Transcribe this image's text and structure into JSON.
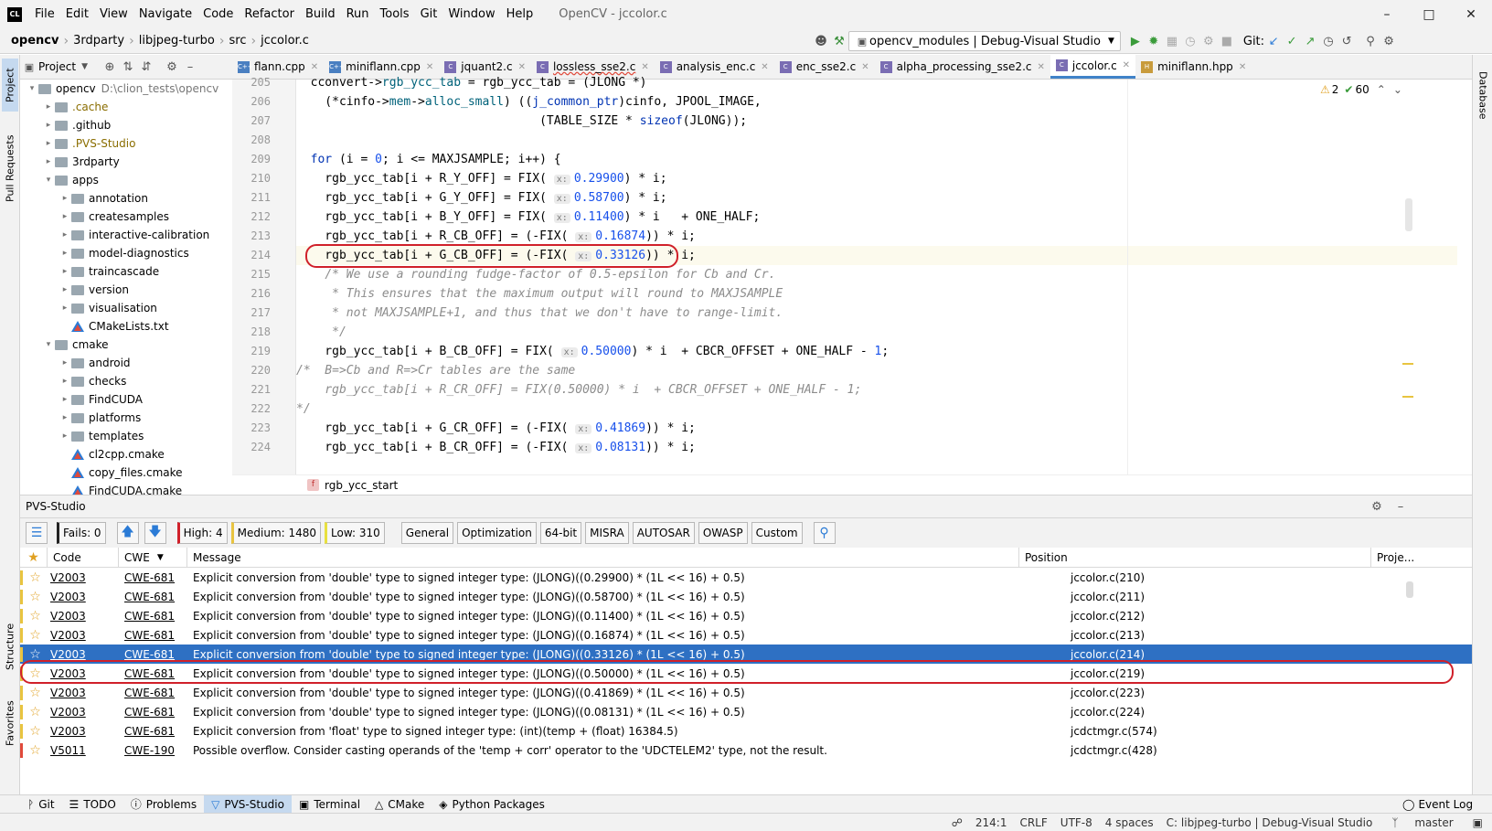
{
  "app": {
    "logo": "CL",
    "menu": [
      "File",
      "Edit",
      "View",
      "Navigate",
      "Code",
      "Refactor",
      "Build",
      "Run",
      "Tools",
      "Git",
      "Window",
      "Help"
    ],
    "window_title": "OpenCV - jccolor.c"
  },
  "nav": {
    "breadcrumbs": [
      "opencv",
      "3rdparty",
      "libjpeg-turbo",
      "src",
      "jccolor.c"
    ],
    "run_config": "opencv_modules | Debug-Visual Studio",
    "git_label": "Git:"
  },
  "left_strip": {
    "project": "Project",
    "pull_requests": "Pull Requests",
    "structure": "Structure",
    "favorites": "Favorites"
  },
  "right_strip": {
    "database": "Database"
  },
  "project_panel": {
    "title": "Project",
    "tree": [
      {
        "depth": 0,
        "open": true,
        "type": "folder",
        "name": "opencv",
        "path": "D:\\clion_tests\\opencv"
      },
      {
        "depth": 1,
        "open": false,
        "type": "folder",
        "name": ".cache",
        "color": "#8a6d00"
      },
      {
        "depth": 1,
        "open": false,
        "type": "folder",
        "name": ".github"
      },
      {
        "depth": 1,
        "open": false,
        "type": "folder",
        "name": ".PVS-Studio",
        "color": "#8a6d00"
      },
      {
        "depth": 1,
        "open": false,
        "type": "folder",
        "name": "3rdparty"
      },
      {
        "depth": 1,
        "open": true,
        "type": "folder",
        "name": "apps"
      },
      {
        "depth": 2,
        "open": false,
        "type": "folder",
        "name": "annotation"
      },
      {
        "depth": 2,
        "open": false,
        "type": "folder",
        "name": "createsamples"
      },
      {
        "depth": 2,
        "open": false,
        "type": "folder",
        "name": "interactive-calibration"
      },
      {
        "depth": 2,
        "open": false,
        "type": "folder",
        "name": "model-diagnostics"
      },
      {
        "depth": 2,
        "open": false,
        "type": "folder",
        "name": "traincascade"
      },
      {
        "depth": 2,
        "open": false,
        "type": "folder",
        "name": "version"
      },
      {
        "depth": 2,
        "open": false,
        "type": "folder",
        "name": "visualisation"
      },
      {
        "depth": 2,
        "open": null,
        "type": "cmake",
        "name": "CMakeLists.txt"
      },
      {
        "depth": 1,
        "open": true,
        "type": "folder",
        "name": "cmake"
      },
      {
        "depth": 2,
        "open": false,
        "type": "folder",
        "name": "android"
      },
      {
        "depth": 2,
        "open": false,
        "type": "folder",
        "name": "checks"
      },
      {
        "depth": 2,
        "open": false,
        "type": "folder",
        "name": "FindCUDA"
      },
      {
        "depth": 2,
        "open": false,
        "type": "folder",
        "name": "platforms"
      },
      {
        "depth": 2,
        "open": false,
        "type": "folder",
        "name": "templates"
      },
      {
        "depth": 2,
        "open": null,
        "type": "cmake",
        "name": "cl2cpp.cmake"
      },
      {
        "depth": 2,
        "open": null,
        "type": "cmake",
        "name": "copy_files.cmake"
      },
      {
        "depth": 2,
        "open": null,
        "type": "cmake",
        "name": "FindCUDA.cmake"
      }
    ]
  },
  "tabs": [
    {
      "label": "flann.cpp",
      "icon": "C++",
      "err": false,
      "active": false
    },
    {
      "label": "miniflann.cpp",
      "icon": "C++",
      "err": false,
      "active": false
    },
    {
      "label": "jquant2.c",
      "icon": "C",
      "err": false,
      "active": false
    },
    {
      "label": "lossless_sse2.c",
      "icon": "C",
      "err": true,
      "active": false
    },
    {
      "label": "analysis_enc.c",
      "icon": "C",
      "err": false,
      "active": false
    },
    {
      "label": "enc_sse2.c",
      "icon": "C",
      "err": false,
      "active": false
    },
    {
      "label": "alpha_processing_sse2.c",
      "icon": "C",
      "err": false,
      "active": false
    },
    {
      "label": "jccolor.c",
      "icon": "C",
      "err": false,
      "active": true
    },
    {
      "label": "miniflann.hpp",
      "icon": "H",
      "err": false,
      "active": false
    }
  ],
  "inspections": {
    "warnings": "2",
    "ok": "60"
  },
  "editor": {
    "lines": [
      {
        "n": "205",
        "html": "  cconvert-><span class='fn'>rgb_ycc_tab</span> = rgb_ycc_tab = (JLONG *)"
      },
      {
        "n": "206",
        "html": "    (*cinfo-><span class='fn'>mem</span>-><span class='fn'>alloc_small</span>) ((<span class='kw'>j_common_ptr</span>)cinfo, JPOOL_IMAGE,"
      },
      {
        "n": "207",
        "html": "                                  (TABLE_SIZE * <span class='kw'>sizeof</span>(JLONG));"
      },
      {
        "n": "208",
        "html": ""
      },
      {
        "n": "209",
        "html": "  <span class='kw'>for</span> (i = <span class='num'>0</span>; i &lt;= MAXJSAMPLE; i++) {"
      },
      {
        "n": "210",
        "html": "    rgb_ycc_tab[i + R_Y_OFF] = FIX( <span class='hint'>x:</span><span class='num'>0.29900</span>) * i;"
      },
      {
        "n": "211",
        "html": "    rgb_ycc_tab[i + G_Y_OFF] = FIX( <span class='hint'>x:</span><span class='num'>0.58700</span>) * i;"
      },
      {
        "n": "212",
        "html": "    rgb_ycc_tab[i + B_Y_OFF] = FIX( <span class='hint'>x:</span><span class='num'>0.11400</span>) * i   + ONE_HALF;"
      },
      {
        "n": "213",
        "html": "    rgb_ycc_tab[i + R_CB_OFF] = (-FIX( <span class='hint'>x:</span><span class='num'>0.16874</span>)) * i;"
      },
      {
        "n": "214",
        "html": "    rgb_ycc_tab[i + G_CB_OFF] = (-FIX( <span class='hint'>x:</span><span class='num'>0.33126</span>)) * i;"
      },
      {
        "n": "215",
        "html": "    <span class='cmt'>/* We use a rounding fudge-factor of 0.5-epsilon for Cb and Cr.</span>"
      },
      {
        "n": "216",
        "html": "<span class='cmt'>     * This ensures that the maximum output will round to MAXJSAMPLE</span>"
      },
      {
        "n": "217",
        "html": "<span class='cmt'>     * not MAXJSAMPLE+1, and thus that we don't have to range-limit.</span>"
      },
      {
        "n": "218",
        "html": "<span class='cmt'>     */</span>"
      },
      {
        "n": "219",
        "html": "    rgb_ycc_tab[i + B_CB_OFF] = FIX( <span class='hint'>x:</span><span class='num'>0.50000</span>) * i  + CBCR_OFFSET + ONE_HALF - <span class='num'>1</span>;"
      },
      {
        "n": "220",
        "html": "<span class='cmt'>/*  B=>Cb and R=>Cr tables are the same</span>"
      },
      {
        "n": "221",
        "html": "<span class='cmt'>    rgb_ycc_tab[i + R_CR_OFF] = FIX(0.50000) * i  + CBCR_OFFSET + ONE_HALF - 1;</span>"
      },
      {
        "n": "222",
        "html": "<span class='cmt'>*/</span>"
      },
      {
        "n": "223",
        "html": "    rgb_ycc_tab[i + G_CR_OFF] = (-FIX( <span class='hint'>x:</span><span class='num'>0.41869</span>)) * i;"
      },
      {
        "n": "224",
        "html": "    rgb_ycc_tab[i + B_CR_OFF] = (-FIX( <span class='hint'>x:</span><span class='num'>0.08131</span>)) * i;"
      }
    ],
    "current_line": "214",
    "function_crumb": "rgb_ycc_start"
  },
  "pvs": {
    "title": "PVS-Studio",
    "fails": "Fails: 0",
    "high": "High: 4",
    "medium": "Medium: 1480",
    "low": "Low: 310",
    "filters": [
      "General",
      "Optimization",
      "64-bit",
      "MISRA",
      "AUTOSAR",
      "OWASP",
      "Custom"
    ],
    "columns": {
      "code": "Code",
      "cwe": "CWE",
      "message": "Message",
      "position": "Position",
      "project": "Proje..."
    },
    "rows": [
      {
        "code": "V2003",
        "cwe": "CWE-681",
        "msg": "Explicit conversion from 'double' type to signed integer type: (JLONG)((0.29900) * (1L << 16) + 0.5)",
        "pos": "jccolor.c(210)",
        "sel": false,
        "level": "low"
      },
      {
        "code": "V2003",
        "cwe": "CWE-681",
        "msg": "Explicit conversion from 'double' type to signed integer type: (JLONG)((0.58700) * (1L << 16) + 0.5)",
        "pos": "jccolor.c(211)",
        "sel": false,
        "level": "low"
      },
      {
        "code": "V2003",
        "cwe": "CWE-681",
        "msg": "Explicit conversion from 'double' type to signed integer type: (JLONG)((0.11400) * (1L << 16) + 0.5)",
        "pos": "jccolor.c(212)",
        "sel": false,
        "level": "low"
      },
      {
        "code": "V2003",
        "cwe": "CWE-681",
        "msg": "Explicit conversion from 'double' type to signed integer type: (JLONG)((0.16874) * (1L << 16) + 0.5)",
        "pos": "jccolor.c(213)",
        "sel": false,
        "level": "low"
      },
      {
        "code": "V2003",
        "cwe": "CWE-681",
        "msg": "Explicit conversion from 'double' type to signed integer type: (JLONG)((0.33126) * (1L << 16) + 0.5)",
        "pos": "jccolor.c(214)",
        "sel": true,
        "level": "low"
      },
      {
        "code": "V2003",
        "cwe": "CWE-681",
        "msg": "Explicit conversion from 'double' type to signed integer type: (JLONG)((0.50000) * (1L << 16) + 0.5)",
        "pos": "jccolor.c(219)",
        "sel": false,
        "level": "low"
      },
      {
        "code": "V2003",
        "cwe": "CWE-681",
        "msg": "Explicit conversion from 'double' type to signed integer type: (JLONG)((0.41869) * (1L << 16) + 0.5)",
        "pos": "jccolor.c(223)",
        "sel": false,
        "level": "low"
      },
      {
        "code": "V2003",
        "cwe": "CWE-681",
        "msg": "Explicit conversion from 'double' type to signed integer type: (JLONG)((0.08131) * (1L << 16) + 0.5)",
        "pos": "jccolor.c(224)",
        "sel": false,
        "level": "low"
      },
      {
        "code": "V2003",
        "cwe": "CWE-681",
        "msg": "Explicit conversion from 'float' type to signed integer type: (int)(temp + (float) 16384.5)",
        "pos": "jcdctmgr.c(574)",
        "sel": false,
        "level": "low"
      },
      {
        "code": "V5011",
        "cwe": "CWE-190",
        "msg": "Possible overflow. Consider casting operands of the 'temp + corr' operator to the 'UDCTELEM2' type, not the result.",
        "pos": "jcdctmgr.c(428)",
        "sel": false,
        "level": "high"
      }
    ]
  },
  "bottom_tools": [
    {
      "label": "Git",
      "icon": "branch-icon",
      "active": false
    },
    {
      "label": "TODO",
      "icon": "list-icon",
      "active": false
    },
    {
      "label": "Problems",
      "icon": "info-icon",
      "active": false
    },
    {
      "label": "PVS-Studio",
      "icon": "pvs-icon",
      "active": true
    },
    {
      "label": "Terminal",
      "icon": "terminal-icon",
      "active": false
    },
    {
      "label": "CMake",
      "icon": "cmake-icon",
      "active": false
    },
    {
      "label": "Python Packages",
      "icon": "layers-icon",
      "active": false
    }
  ],
  "event_log": "Event Log",
  "status": {
    "pos": "214:1",
    "eol": "CRLF",
    "enc": "UTF-8",
    "indent": "4 spaces",
    "context": "C: libjpeg-turbo | Debug-Visual Studio",
    "branch": "master"
  },
  "colors": {
    "accent": "#2e70c3",
    "highlight": "#d0202a",
    "active_tab": "#4083c9"
  }
}
